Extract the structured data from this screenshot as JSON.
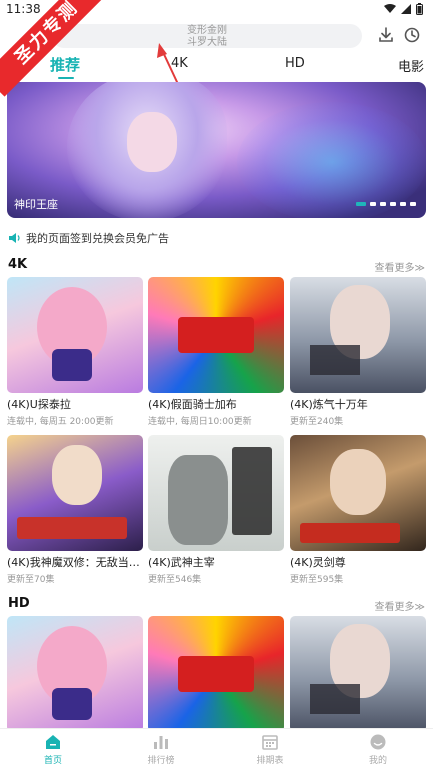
{
  "status_bar": {
    "time": "11:38"
  },
  "watermark": {
    "text": "圣力专测"
  },
  "search": {
    "hint_line1": "变形金刚",
    "hint_line2": "斗罗大陆"
  },
  "tabs": [
    "推荐",
    "4K",
    "HD",
    "电影"
  ],
  "active_tab": "推荐",
  "banner": {
    "caption": "神印王座",
    "slide_count": 6,
    "active_slide": 1
  },
  "notice": {
    "text": "我的页面签到兑换会员免广告"
  },
  "sections": [
    {
      "title": "4K",
      "more": "查看更多≫",
      "items": [
        {
          "title": "(4K)U探泰拉",
          "sub": "连载中, 每周五 20:00更新"
        },
        {
          "title": "(4K)假面骑士加布",
          "sub": "连载中, 每周日10:00更新"
        },
        {
          "title": "(4K)炼气十万年",
          "sub": "更新至240集"
        },
        {
          "title": "(4K)我神魔双修：无敌当世...",
          "sub": "更新至70集"
        },
        {
          "title": "(4K)武神主宰",
          "sub": "更新至546集"
        },
        {
          "title": "(4K)灵剑尊",
          "sub": "更新至595集"
        }
      ]
    },
    {
      "title": "HD",
      "more": "查看更多≫"
    }
  ],
  "bottom_nav": [
    {
      "label": "首页",
      "icon": "home-icon"
    },
    {
      "label": "排行榜",
      "icon": "chart-icon"
    },
    {
      "label": "排期表",
      "icon": "calendar-icon"
    },
    {
      "label": "我的",
      "icon": "profile-icon"
    }
  ],
  "colors": {
    "accent": "#18b3b3",
    "watermark": "#e8292c"
  }
}
